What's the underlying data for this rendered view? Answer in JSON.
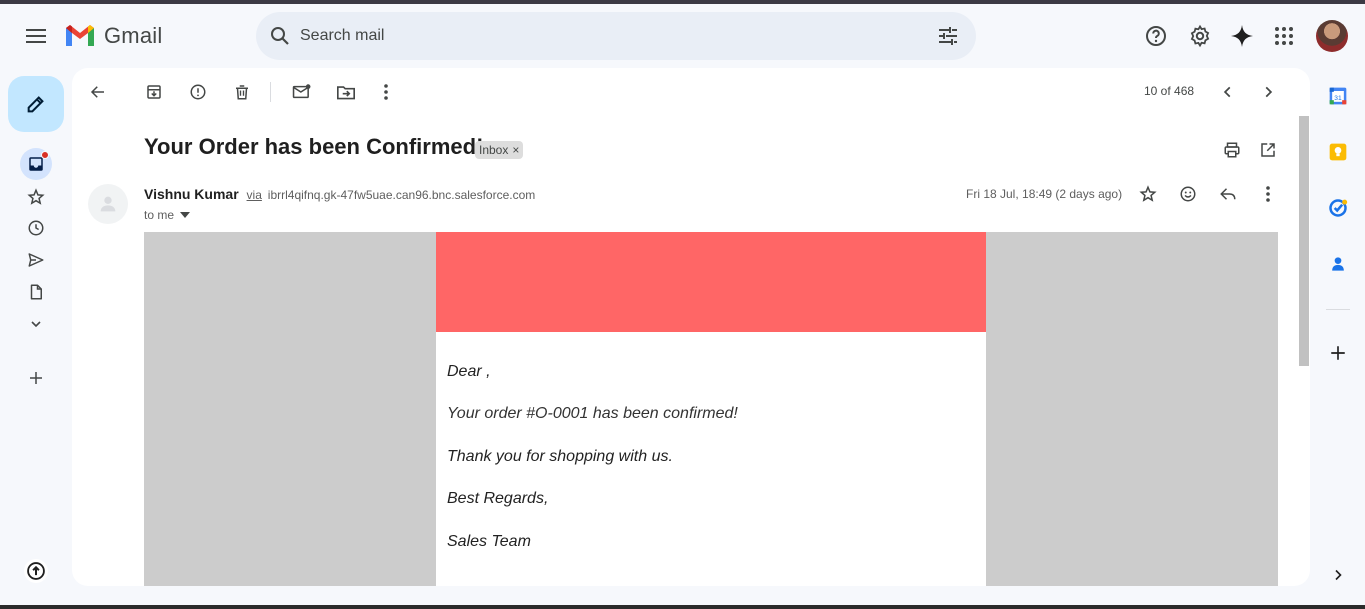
{
  "app": {
    "name": "Gmail"
  },
  "search": {
    "placeholder": "Search mail"
  },
  "toolbar": {
    "count": "10 of 468"
  },
  "message": {
    "subject": "Your Order has been Confirmed!",
    "label": "Inbox",
    "label_remove": "×",
    "sender_name": "Vishnu Kumar",
    "via": "via",
    "sender_email": "ibrrl4qifnq.gk-47fw5uae.can96.bnc.salesforce.com",
    "to": "to me",
    "date": "Fri 18 Jul, 18:49 (2 days ago)"
  },
  "email_content": {
    "banner_color": "#ff6666",
    "lines": [
      "Dear ,",
      "Your order #O-0001 has been confirmed!",
      "Thank you for shopping with us.",
      "Best Regards,",
      "Sales Team"
    ]
  },
  "colors": {
    "compose_bg": "#c2e7ff",
    "search_bg": "#e9eef6",
    "page_bg": "#f6f8fc",
    "unread_dot": "#d93025"
  },
  "icons": {
    "header": [
      "menu-icon",
      "gmail-logo-icon",
      "search-icon",
      "tune-icon",
      "help-icon",
      "settings-icon",
      "gemini-icon",
      "apps-icon"
    ],
    "left_rail": [
      "pencil-icon",
      "inbox-icon",
      "star-icon",
      "clock-icon",
      "send-icon",
      "draft-icon",
      "chevron-down-icon",
      "plus-icon",
      "upgrade-icon"
    ],
    "toolbar": [
      "back-arrow-icon",
      "archive-icon",
      "report-spam-icon",
      "delete-icon",
      "mark-unread-icon",
      "move-to-icon",
      "more-vert-icon",
      "chevron-left-icon",
      "chevron-right-icon"
    ],
    "right_rail": [
      "calendar-icon",
      "keep-icon",
      "tasks-icon",
      "contacts-icon",
      "plus-icon",
      "chevron-right-icon"
    ]
  }
}
